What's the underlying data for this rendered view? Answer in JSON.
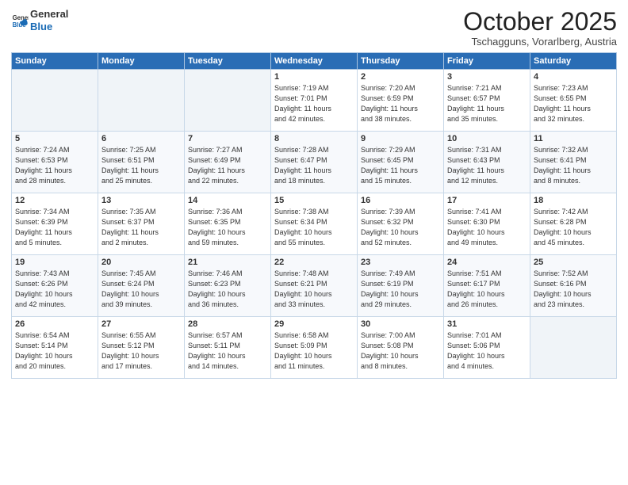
{
  "header": {
    "logo_general": "General",
    "logo_blue": "Blue",
    "month": "October 2025",
    "location": "Tschagguns, Vorarlberg, Austria"
  },
  "weekdays": [
    "Sunday",
    "Monday",
    "Tuesday",
    "Wednesday",
    "Thursday",
    "Friday",
    "Saturday"
  ],
  "weeks": [
    [
      {
        "day": "",
        "info": ""
      },
      {
        "day": "",
        "info": ""
      },
      {
        "day": "",
        "info": ""
      },
      {
        "day": "1",
        "info": "Sunrise: 7:19 AM\nSunset: 7:01 PM\nDaylight: 11 hours\nand 42 minutes."
      },
      {
        "day": "2",
        "info": "Sunrise: 7:20 AM\nSunset: 6:59 PM\nDaylight: 11 hours\nand 38 minutes."
      },
      {
        "day": "3",
        "info": "Sunrise: 7:21 AM\nSunset: 6:57 PM\nDaylight: 11 hours\nand 35 minutes."
      },
      {
        "day": "4",
        "info": "Sunrise: 7:23 AM\nSunset: 6:55 PM\nDaylight: 11 hours\nand 32 minutes."
      }
    ],
    [
      {
        "day": "5",
        "info": "Sunrise: 7:24 AM\nSunset: 6:53 PM\nDaylight: 11 hours\nand 28 minutes."
      },
      {
        "day": "6",
        "info": "Sunrise: 7:25 AM\nSunset: 6:51 PM\nDaylight: 11 hours\nand 25 minutes."
      },
      {
        "day": "7",
        "info": "Sunrise: 7:27 AM\nSunset: 6:49 PM\nDaylight: 11 hours\nand 22 minutes."
      },
      {
        "day": "8",
        "info": "Sunrise: 7:28 AM\nSunset: 6:47 PM\nDaylight: 11 hours\nand 18 minutes."
      },
      {
        "day": "9",
        "info": "Sunrise: 7:29 AM\nSunset: 6:45 PM\nDaylight: 11 hours\nand 15 minutes."
      },
      {
        "day": "10",
        "info": "Sunrise: 7:31 AM\nSunset: 6:43 PM\nDaylight: 11 hours\nand 12 minutes."
      },
      {
        "day": "11",
        "info": "Sunrise: 7:32 AM\nSunset: 6:41 PM\nDaylight: 11 hours\nand 8 minutes."
      }
    ],
    [
      {
        "day": "12",
        "info": "Sunrise: 7:34 AM\nSunset: 6:39 PM\nDaylight: 11 hours\nand 5 minutes."
      },
      {
        "day": "13",
        "info": "Sunrise: 7:35 AM\nSunset: 6:37 PM\nDaylight: 11 hours\nand 2 minutes."
      },
      {
        "day": "14",
        "info": "Sunrise: 7:36 AM\nSunset: 6:35 PM\nDaylight: 10 hours\nand 59 minutes."
      },
      {
        "day": "15",
        "info": "Sunrise: 7:38 AM\nSunset: 6:34 PM\nDaylight: 10 hours\nand 55 minutes."
      },
      {
        "day": "16",
        "info": "Sunrise: 7:39 AM\nSunset: 6:32 PM\nDaylight: 10 hours\nand 52 minutes."
      },
      {
        "day": "17",
        "info": "Sunrise: 7:41 AM\nSunset: 6:30 PM\nDaylight: 10 hours\nand 49 minutes."
      },
      {
        "day": "18",
        "info": "Sunrise: 7:42 AM\nSunset: 6:28 PM\nDaylight: 10 hours\nand 45 minutes."
      }
    ],
    [
      {
        "day": "19",
        "info": "Sunrise: 7:43 AM\nSunset: 6:26 PM\nDaylight: 10 hours\nand 42 minutes."
      },
      {
        "day": "20",
        "info": "Sunrise: 7:45 AM\nSunset: 6:24 PM\nDaylight: 10 hours\nand 39 minutes."
      },
      {
        "day": "21",
        "info": "Sunrise: 7:46 AM\nSunset: 6:23 PM\nDaylight: 10 hours\nand 36 minutes."
      },
      {
        "day": "22",
        "info": "Sunrise: 7:48 AM\nSunset: 6:21 PM\nDaylight: 10 hours\nand 33 minutes."
      },
      {
        "day": "23",
        "info": "Sunrise: 7:49 AM\nSunset: 6:19 PM\nDaylight: 10 hours\nand 29 minutes."
      },
      {
        "day": "24",
        "info": "Sunrise: 7:51 AM\nSunset: 6:17 PM\nDaylight: 10 hours\nand 26 minutes."
      },
      {
        "day": "25",
        "info": "Sunrise: 7:52 AM\nSunset: 6:16 PM\nDaylight: 10 hours\nand 23 minutes."
      }
    ],
    [
      {
        "day": "26",
        "info": "Sunrise: 6:54 AM\nSunset: 5:14 PM\nDaylight: 10 hours\nand 20 minutes."
      },
      {
        "day": "27",
        "info": "Sunrise: 6:55 AM\nSunset: 5:12 PM\nDaylight: 10 hours\nand 17 minutes."
      },
      {
        "day": "28",
        "info": "Sunrise: 6:57 AM\nSunset: 5:11 PM\nDaylight: 10 hours\nand 14 minutes."
      },
      {
        "day": "29",
        "info": "Sunrise: 6:58 AM\nSunset: 5:09 PM\nDaylight: 10 hours\nand 11 minutes."
      },
      {
        "day": "30",
        "info": "Sunrise: 7:00 AM\nSunset: 5:08 PM\nDaylight: 10 hours\nand 8 minutes."
      },
      {
        "day": "31",
        "info": "Sunrise: 7:01 AM\nSunset: 5:06 PM\nDaylight: 10 hours\nand 4 minutes."
      },
      {
        "day": "",
        "info": ""
      }
    ]
  ]
}
